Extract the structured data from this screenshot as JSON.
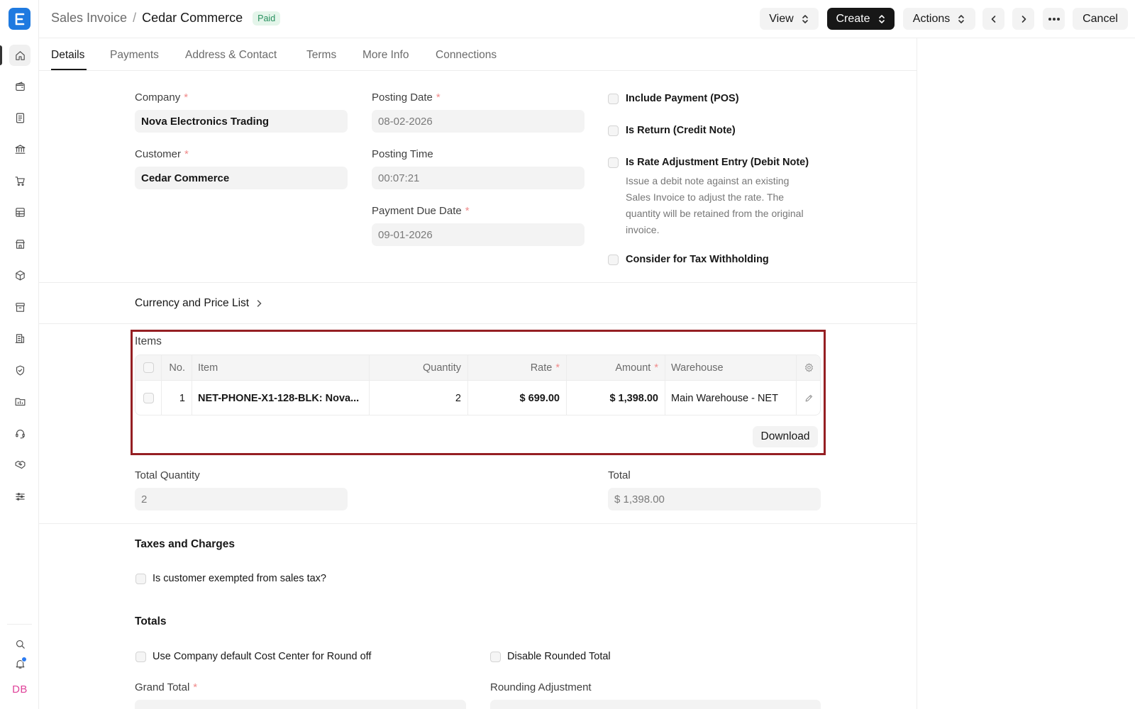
{
  "header": {
    "breadcrumb_parent": "Sales Invoice",
    "breadcrumb_separator": "/",
    "title": "Cedar Commerce",
    "status_badge": "Paid",
    "view_label": "View",
    "create_label": "Create",
    "actions_label": "Actions",
    "cancel_label": "Cancel"
  },
  "tabs": [
    "Details",
    "Payments",
    "Address & Contact",
    "Terms",
    "More Info",
    "Connections"
  ],
  "sidebar": {
    "icons": [
      "home-icon",
      "wallet-icon",
      "document-icon",
      "bank-icon",
      "cart-icon",
      "table-icon",
      "store-icon",
      "box-icon",
      "archive-icon",
      "building-icon",
      "shield-icon",
      "folder-icon",
      "headset-icon",
      "handshake-icon",
      "sliders-icon"
    ],
    "bottom_icons": [
      "search-icon",
      "bell-icon"
    ],
    "avatar_initials": "DB"
  },
  "form": {
    "company_label": "Company",
    "company_value": "Nova Electronics Trading",
    "customer_label": "Customer",
    "customer_value": "Cedar Commerce",
    "posting_date_label": "Posting Date",
    "posting_date_value": "08-02-2026",
    "posting_time_label": "Posting Time",
    "posting_time_value": "00:07:21",
    "payment_due_date_label": "Payment Due Date",
    "payment_due_date_value": "09-01-2026",
    "required_marker": "*",
    "checks": {
      "include_payment": "Include Payment (POS)",
      "is_return": "Is Return (Credit Note)",
      "rate_adjustment": "Is Rate Adjustment Entry (Debit Note)",
      "rate_adjustment_desc": "Issue a debit note against an existing Sales Invoice to adjust the rate. The quantity will be retained from the original invoice.",
      "tax_withholding": "Consider for Tax Withholding"
    }
  },
  "currency_section": "Currency and Price List",
  "items": {
    "title": "Items",
    "columns": {
      "no": "No.",
      "item": "Item",
      "quantity": "Quantity",
      "rate": "Rate",
      "amount": "Amount",
      "warehouse": "Warehouse"
    },
    "rows": [
      {
        "no": "1",
        "item": "NET-PHONE-X1-128-BLK: Nova...",
        "quantity": "2",
        "rate": "$ 699.00",
        "amount": "$ 1,398.00",
        "warehouse": "Main Warehouse - NET"
      }
    ],
    "download_label": "Download"
  },
  "totals_row": {
    "total_quantity_label": "Total Quantity",
    "total_quantity_value": "2",
    "total_label": "Total",
    "total_value": "$ 1,398.00"
  },
  "taxes": {
    "title": "Taxes and Charges",
    "exempt_label": "Is customer exempted from sales tax?"
  },
  "totals": {
    "title": "Totals",
    "cost_center_label": "Use Company default Cost Center for Round off",
    "disable_rounded_label": "Disable Rounded Total",
    "grand_total_label": "Grand Total",
    "rounding_adjustment_label": "Rounding Adjustment"
  },
  "colors": {
    "accent": "#1f7ae0",
    "highlight_border": "#951f23",
    "paid_badge_bg": "#e4f5ea",
    "paid_badge_text": "#278f5e"
  }
}
